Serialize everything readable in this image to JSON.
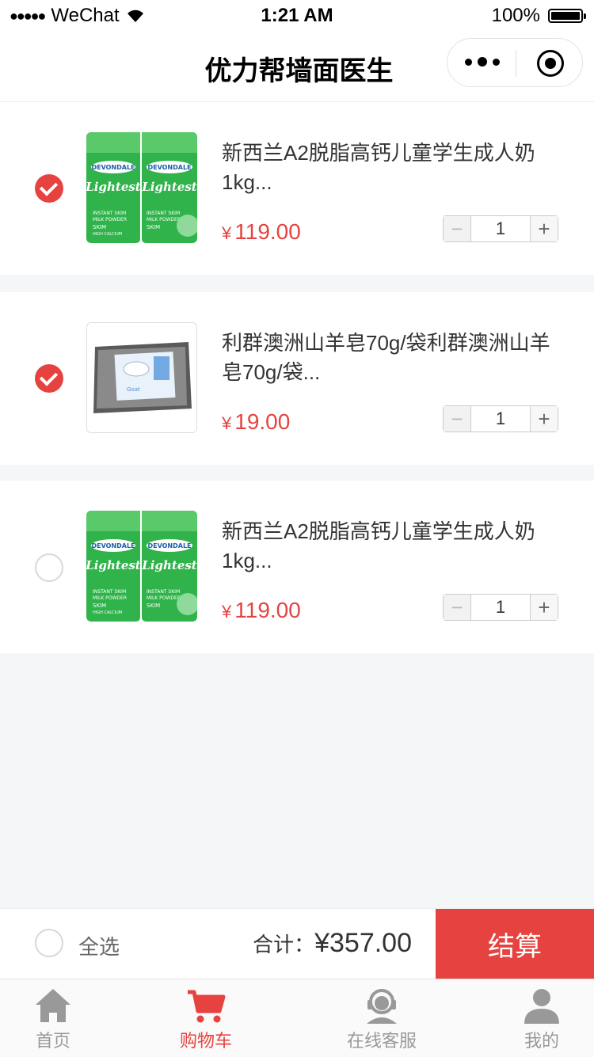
{
  "status_bar": {
    "carrier": "WeChat",
    "time": "1:21 AM",
    "battery": "100%"
  },
  "nav": {
    "title": "优力帮墙面医生",
    "more_icon": "more-dots-icon",
    "close_icon": "close-target-icon"
  },
  "cart": {
    "currency": "¥",
    "items": [
      {
        "name": "新西兰A2脱脂高钙儿童学生成人奶1kg...",
        "price": "119.00",
        "qty": "1",
        "checked": true,
        "image": "devondale-milk-powder"
      },
      {
        "name": "利群澳洲山羊皂70g/袋利群澳洲山羊皂70g/袋...",
        "price": "19.00",
        "qty": "1",
        "checked": true,
        "image": "goat-milk-soap"
      },
      {
        "name": "新西兰A2脱脂高钙儿童学生成人奶1kg...",
        "price": "119.00",
        "qty": "1",
        "checked": false,
        "image": "devondale-milk-powder"
      }
    ],
    "minus": "−",
    "plus": "+"
  },
  "checkout": {
    "select_all": "全选",
    "total_label": "合计：",
    "total_amount": "¥357.00",
    "pay_label": "结算"
  },
  "tabbar": {
    "items": [
      {
        "label": "首页",
        "icon": "home-icon",
        "active": false
      },
      {
        "label": "购物车",
        "icon": "cart-icon",
        "active": true
      },
      {
        "label": "在线客服",
        "icon": "support-icon",
        "active": false
      },
      {
        "label": "我的",
        "icon": "user-icon",
        "active": false
      }
    ]
  },
  "colors": {
    "accent": "#e64340",
    "milk_green": "#2bb24c",
    "tab_inactive": "#999999"
  }
}
